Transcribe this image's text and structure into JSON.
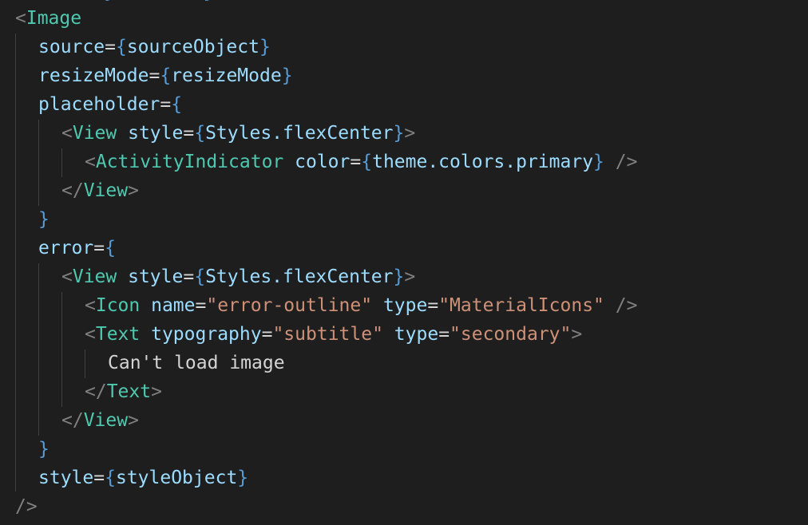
{
  "editor": {
    "lines": [
      {
        "indent": 0,
        "tokens": [
          [
            "tag",
            "<"
          ],
          [
            "comp",
            "Image"
          ]
        ]
      },
      {
        "indent": 1,
        "tokens": [
          [
            "attr",
            "source"
          ],
          [
            "op",
            "="
          ],
          [
            "brace",
            "{"
          ],
          [
            "expr",
            "sourceObject"
          ],
          [
            "brace",
            "}"
          ]
        ]
      },
      {
        "indent": 1,
        "tokens": [
          [
            "attr",
            "resizeMode"
          ],
          [
            "op",
            "="
          ],
          [
            "brace",
            "{"
          ],
          [
            "expr",
            "resizeMode"
          ],
          [
            "brace",
            "}"
          ]
        ]
      },
      {
        "indent": 1,
        "tokens": [
          [
            "attr",
            "placeholder"
          ],
          [
            "op",
            "="
          ],
          [
            "brace",
            "{"
          ]
        ]
      },
      {
        "indent": 2,
        "tokens": [
          [
            "tag",
            "<"
          ],
          [
            "comp",
            "View"
          ],
          [
            "op",
            " "
          ],
          [
            "attr",
            "style"
          ],
          [
            "op",
            "="
          ],
          [
            "brace",
            "{"
          ],
          [
            "expr",
            "Styles.flexCenter"
          ],
          [
            "brace",
            "}"
          ],
          [
            "tag",
            ">"
          ]
        ]
      },
      {
        "indent": 3,
        "tokens": [
          [
            "tag",
            "<"
          ],
          [
            "comp",
            "ActivityIndicator"
          ],
          [
            "op",
            " "
          ],
          [
            "attr",
            "color"
          ],
          [
            "op",
            "="
          ],
          [
            "brace",
            "{"
          ],
          [
            "expr",
            "theme.colors.primary"
          ],
          [
            "brace",
            "}"
          ],
          [
            "op",
            " "
          ],
          [
            "tag",
            "/>"
          ]
        ]
      },
      {
        "indent": 2,
        "tokens": [
          [
            "tag",
            "</"
          ],
          [
            "comp",
            "View"
          ],
          [
            "tag",
            ">"
          ]
        ]
      },
      {
        "indent": 1,
        "tokens": [
          [
            "brace",
            "}"
          ]
        ]
      },
      {
        "indent": 1,
        "tokens": [
          [
            "attr",
            "error"
          ],
          [
            "op",
            "="
          ],
          [
            "brace",
            "{"
          ]
        ]
      },
      {
        "indent": 2,
        "tokens": [
          [
            "tag",
            "<"
          ],
          [
            "comp",
            "View"
          ],
          [
            "op",
            " "
          ],
          [
            "attr",
            "style"
          ],
          [
            "op",
            "="
          ],
          [
            "brace",
            "{"
          ],
          [
            "expr",
            "Styles.flexCenter"
          ],
          [
            "brace",
            "}"
          ],
          [
            "tag",
            ">"
          ]
        ]
      },
      {
        "indent": 3,
        "tokens": [
          [
            "tag",
            "<"
          ],
          [
            "comp",
            "Icon"
          ],
          [
            "op",
            " "
          ],
          [
            "attr",
            "name"
          ],
          [
            "op",
            "="
          ],
          [
            "str",
            "\"error-outline\""
          ],
          [
            "op",
            " "
          ],
          [
            "attr",
            "type"
          ],
          [
            "op",
            "="
          ],
          [
            "str",
            "\"MaterialIcons\""
          ],
          [
            "op",
            " "
          ],
          [
            "tag",
            "/>"
          ]
        ]
      },
      {
        "indent": 3,
        "tokens": [
          [
            "tag",
            "<"
          ],
          [
            "comp",
            "Text"
          ],
          [
            "op",
            " "
          ],
          [
            "attr",
            "typography"
          ],
          [
            "op",
            "="
          ],
          [
            "str",
            "\"subtitle\""
          ],
          [
            "op",
            " "
          ],
          [
            "attr",
            "type"
          ],
          [
            "op",
            "="
          ],
          [
            "str",
            "\"secondary\""
          ],
          [
            "tag",
            ">"
          ]
        ]
      },
      {
        "indent": 4,
        "tokens": [
          [
            "text",
            "Can't load image"
          ]
        ]
      },
      {
        "indent": 3,
        "tokens": [
          [
            "tag",
            "</"
          ],
          [
            "comp",
            "Text"
          ],
          [
            "tag",
            ">"
          ]
        ]
      },
      {
        "indent": 2,
        "tokens": [
          [
            "tag",
            "</"
          ],
          [
            "comp",
            "View"
          ],
          [
            "tag",
            ">"
          ]
        ]
      },
      {
        "indent": 1,
        "tokens": [
          [
            "brace",
            "}"
          ]
        ]
      },
      {
        "indent": 1,
        "tokens": [
          [
            "attr",
            "style"
          ],
          [
            "op",
            "="
          ],
          [
            "brace",
            "{"
          ],
          [
            "expr",
            "styleObject"
          ],
          [
            "brace",
            "}"
          ]
        ]
      },
      {
        "indent": 0,
        "tokens": [
          [
            "tag",
            "/>"
          ]
        ]
      }
    ]
  }
}
